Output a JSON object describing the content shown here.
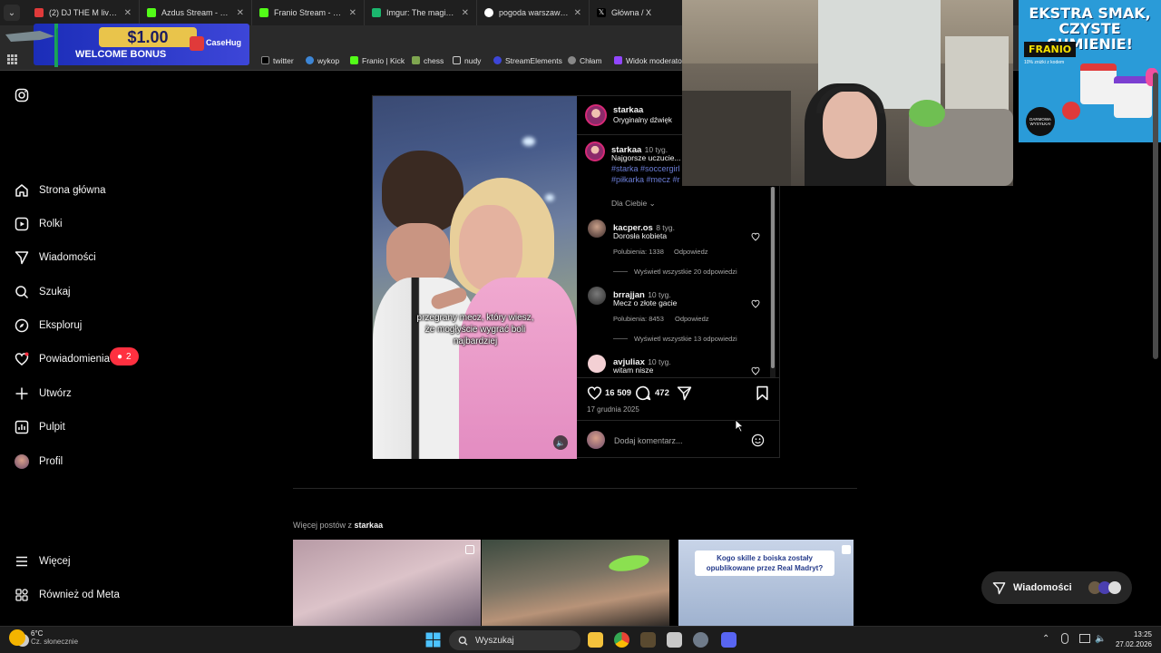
{
  "browser": {
    "tabs": [
      {
        "label": "(2) DJ THE M live at F",
        "color": "#e03a3a"
      },
      {
        "label": "Azdus Stream - Watc",
        "color": "#53fc18"
      },
      {
        "label": "Franio Stream - Watc",
        "color": "#53fc18"
      },
      {
        "label": "Imgur: The magic of t",
        "color": "#1bb76e"
      },
      {
        "label": "pogoda warszawa - S",
        "color": "#ffffff"
      },
      {
        "label": "Główna / X",
        "color": "#ffffff"
      }
    ],
    "bookmarks": [
      "twitter",
      "wykop",
      "Franio | Kick",
      "chess",
      "nudy",
      "StreamElements",
      "Chłam",
      "Widok moderato"
    ]
  },
  "ad_banner": {
    "amount": "$1.00",
    "welcome": "WELCOME BONUS",
    "brand": "CaseHug"
  },
  "sidebar": {
    "items": [
      {
        "label": "Strona główna",
        "icon": "home-icon"
      },
      {
        "label": "Rolki",
        "icon": "reels-icon"
      },
      {
        "label": "Wiadomości",
        "icon": "messages-icon"
      },
      {
        "label": "Szukaj",
        "icon": "search-icon"
      },
      {
        "label": "Eksploruj",
        "icon": "explore-icon"
      },
      {
        "label": "Powiadomienia",
        "icon": "heart-icon"
      },
      {
        "label": "Utwórz",
        "icon": "plus-icon"
      },
      {
        "label": "Pulpit",
        "icon": "dashboard-icon"
      },
      {
        "label": "Profil",
        "icon": "avatar"
      }
    ],
    "notifications_badge": "2",
    "more": "Więcej",
    "meta": "Również od Meta"
  },
  "post": {
    "author": "starkaa",
    "audio": "Oryginalny dźwięk",
    "video_caption": "przegrany mecz, który wiesz, że mogłyście wygrać boli najbardziej",
    "caption": {
      "user": "starkaa",
      "time": "10 tyg.",
      "text": "Najgorsze uczucie...",
      "tags1": "#starka #soccergirl",
      "tags2": "#piłkarka #mecz #r"
    },
    "filter": "Dla Ciebie",
    "comments": [
      {
        "user": "kacper.os",
        "time": "8 tyg.",
        "text": "Dorosła kobieta",
        "likes": "Polubienia: 1338",
        "reply": "Odpowiedz",
        "view": "Wyświetl wszystkie 20 odpowiedzi"
      },
      {
        "user": "brrajjan",
        "time": "10 tyg.",
        "text": "Mecz o złote gacie",
        "likes": "Polubienia: 8453",
        "reply": "Odpowiedz",
        "view": "Wyświetl wszystkie 13 odpowiedzi"
      },
      {
        "user": "avjuliax",
        "time": "10 tyg.",
        "text": "witam nisze"
      }
    ],
    "likes": "16 509",
    "comments_count": "472",
    "date": "17 grudnia 2025",
    "comment_placeholder": "Dodaj komentarz..."
  },
  "more_posts": {
    "prefix": "Więcej postów z",
    "user": "starkaa",
    "thumb3_text": "Kogo skille z boiska zostały opublikowane przez Real Madryt?"
  },
  "promo": {
    "title": "EKSTRA SMAK, CZYSTE SUMIENIE!",
    "brand": "FRANIO",
    "sub": "10% zniżki z kodem",
    "free": "DARMOWA WYSYŁKA!"
  },
  "messages_pill": "Wiadomości",
  "taskbar": {
    "temp": "6°C",
    "weather": "Cz. słonecznie",
    "search": "Wyszukaj",
    "time": "13:25",
    "date": "27.02.2026"
  }
}
